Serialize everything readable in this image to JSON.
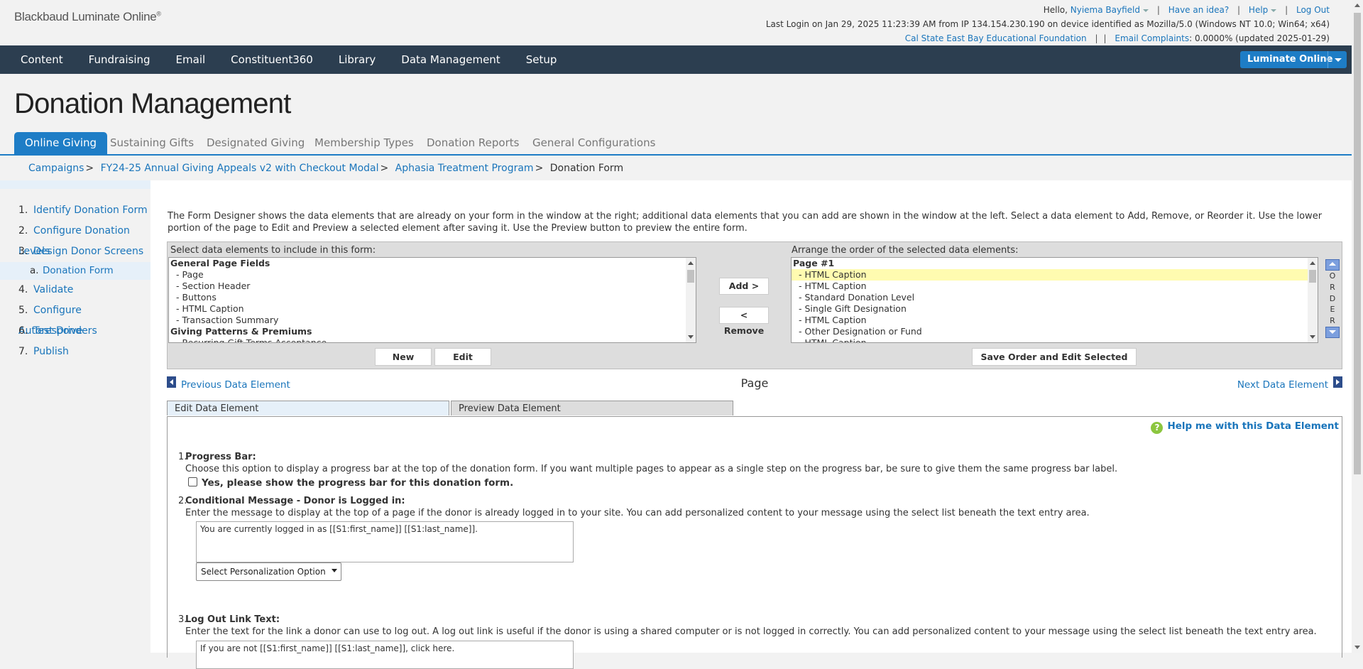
{
  "header": {
    "logo": "Blackbaud Luminate Online",
    "logo_mark": "®",
    "hello": "Hello,",
    "user_name": "Nyiema Bayfield",
    "have_idea": "Have an idea?",
    "help": "Help",
    "logout": "Log Out",
    "last_login": "Last Login on Jan 29, 2025 11:23:39 AM from IP 134.154.230.190 on device identified as Mozilla/5.0 (Windows NT 10.0; Win64; x64)",
    "org_name": "Cal State East Bay Educational Foundation",
    "email_complaints_label": "Email Complaints",
    "email_complaints_value": ": 0.0000% (updated 2025-01-29)"
  },
  "nav": {
    "items": [
      "Content",
      "Fundraising",
      "Email",
      "Constituent360",
      "Library",
      "Data Management",
      "Setup"
    ],
    "app_switcher": "Luminate Online"
  },
  "page": {
    "title": "Donation Management",
    "tabs": [
      "Online Giving",
      "Sustaining Gifts",
      "Designated Giving",
      "Membership Types",
      "Donation Reports",
      "General Configurations"
    ],
    "breadcrumb": [
      "Campaigns",
      "FY24-25 Annual Giving Appeals v2 with Checkout Modal",
      "Aphasia Treatment Program",
      "Donation Form"
    ]
  },
  "steps": [
    {
      "n": "1.",
      "label": "Identify Donation Form"
    },
    {
      "n": "2.",
      "label": "Configure Donation Levels"
    },
    {
      "n": "3.",
      "label": "Design Donor Screens"
    },
    {
      "n": "a.",
      "label": "Donation Form"
    },
    {
      "n": "4.",
      "label": "Validate"
    },
    {
      "n": "5.",
      "label": "Configure Autoresponders"
    },
    {
      "n": "6.",
      "label": "Test Drive"
    },
    {
      "n": "7.",
      "label": "Publish"
    }
  ],
  "designer": {
    "intro": "The Form Designer shows the data elements that are already on your form in the window at the right; additional data elements that you can add are shown in the window at the left. Select a data element to Add, Remove, or Reorder it. Use the lower portion of the page to Edit and Preview a selected element after saving it. Use the Preview button to preview the entire form.",
    "left_header": "Select data elements to include in this form:",
    "right_header": "Arrange the order of the selected data elements:",
    "available": [
      "General Page Fields",
      "- Page",
      "- Section Header",
      "- Buttons",
      "- HTML Caption",
      "- Transaction Summary",
      "Giving Patterns & Premiums",
      "- Recurring Gift Terms Acceptance"
    ],
    "selected": [
      "Page #1",
      "- HTML Caption",
      "- HTML Caption",
      "- Standard Donation Level",
      "- Single Gift Designation",
      "- HTML Caption",
      "- Other Designation or Fund",
      "- HTML Caption"
    ],
    "add_btn": "Add >",
    "remove_btn": "< Remove",
    "new_btn": "New",
    "edit_btn": "Edit",
    "save_btn": "Save Order and Edit Selected",
    "order_letters": [
      "O",
      "R",
      "D",
      "E",
      "R"
    ]
  },
  "element_nav": {
    "prev": "Previous Data Element",
    "next": "Next Data Element",
    "current": "Page"
  },
  "edit_tabs": {
    "edit": "Edit Data Element",
    "preview": "Preview Data Element",
    "help": "Help me with this Data Element"
  },
  "fields": {
    "q1_num": "1.",
    "q1_title": "Progress Bar:",
    "q1_desc": "Choose this option to display a progress bar at the top of the donation form. If you want multiple pages to appear as a single step on the progress bar, be sure to give them the same progress bar label.",
    "q1_checkbox": "Yes, please show the progress bar for this donation form.",
    "q2_num": "2.",
    "q2_title": "Conditional Message - Donor is Logged in:",
    "q2_desc": "Enter the message to display at the top of a page if the donor is already logged in to your site. You can add personalized content to your message using the select list beneath the text entry area.",
    "q2_value": "You are currently logged in as [[S1:first_name]] [[S1:last_name]].",
    "q2_select": "Select Personalization Option",
    "q3_num": "3.",
    "q3_title": "Log Out Link Text:",
    "q3_desc": "Enter the text for the link a donor can use to log out. A log out link is useful if the donor is using a shared computer or is not logged in correctly. You can add personalized content to your message using the select list beneath the text entry area.",
    "q3_value": "If you are not [[S1:first_name]] [[S1:last_name]], click here."
  }
}
